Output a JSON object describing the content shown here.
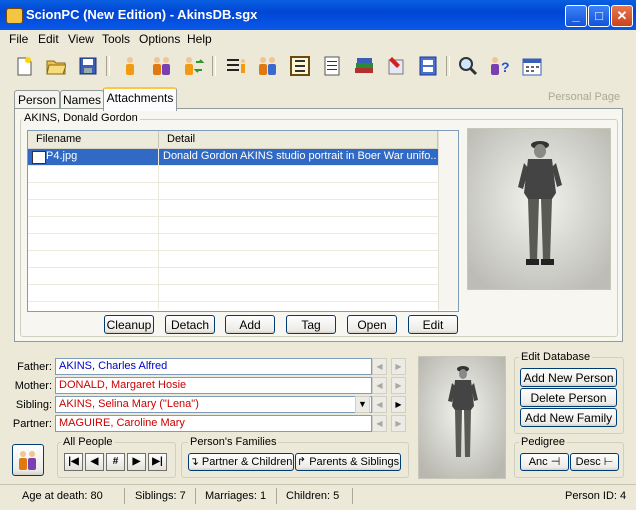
{
  "window": {
    "title": "ScionPC (New Edition) - AkinsDB.sgx",
    "minimize": "_",
    "maximize": "□",
    "close": "✕"
  },
  "menu": [
    "File",
    "Edit",
    "View",
    "Tools",
    "Options",
    "Help"
  ],
  "tabs": {
    "person": "Person",
    "names": "Names",
    "attachments": "Attachments",
    "page_label": "Personal Page"
  },
  "attachments": {
    "person_name": "AKINS, Donald Gordon",
    "columns": {
      "filename": "Filename",
      "detail": "Detail"
    },
    "rows": [
      {
        "filename": "P4.jpg",
        "detail": "Donald Gordon AKINS studio portrait in Boer War unifo..."
      }
    ],
    "buttons": {
      "cleanup": "Cleanup",
      "detach": "Detach",
      "add": "Add",
      "tag": "Tag",
      "open": "Open",
      "edit": "Edit"
    }
  },
  "relations": {
    "father_label": "Father:",
    "father": "AKINS, Charles Alfred",
    "mother_label": "Mother:",
    "mother": "DONALD, Margaret Hosie",
    "sibling_label": "Sibling:",
    "sibling": "AKINS, Selina Mary (\"Lena\")",
    "partner_label": "Partner:",
    "partner": "MAGUIRE, Caroline Mary"
  },
  "colors": {
    "father": "#0000cc",
    "mother": "#cc0000",
    "sibling": "#cc0000",
    "partner": "#cc0000",
    "selection": "#316ac5"
  },
  "all_people": {
    "label": "All People",
    "first": "|◀",
    "prev": "◀",
    "find": "#",
    "next": "▶",
    "last": "▶|"
  },
  "families": {
    "label": "Person's Families",
    "partner_children": "↴ Partner & Children",
    "parents_siblings": "↱ Parents & Siblings"
  },
  "edit_db": {
    "label": "Edit Database",
    "add_person": "Add New Person",
    "delete_person": "Delete Person",
    "add_family": "Add New Family"
  },
  "pedigree": {
    "label": "Pedigree",
    "anc": "Anc",
    "desc": "Desc"
  },
  "status": {
    "age": "Age at death: 80",
    "siblings": "Siblings: 7",
    "marriages": "Marriages: 1",
    "children": "Children: 5",
    "person_id": "Person ID: 4"
  }
}
